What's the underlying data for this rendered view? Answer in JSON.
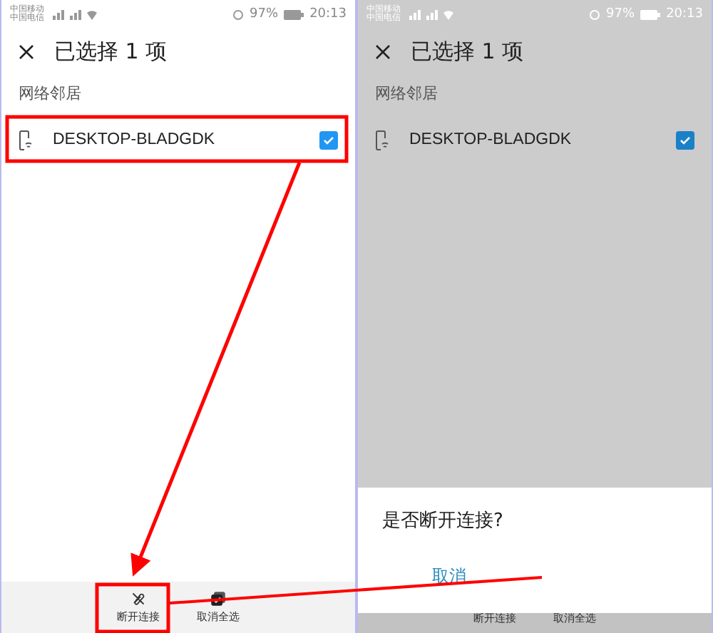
{
  "screens": [
    {
      "dimmed": false,
      "status_bar": {
        "carriers": [
          "中国移动",
          "中国电信"
        ],
        "battery": "97%",
        "time": "20:13"
      },
      "header": {
        "title": "已选择 1 项"
      },
      "section": "网络邻居",
      "devices": [
        {
          "name": "DESKTOP-BLADGDK",
          "checked": true
        }
      ],
      "bottom_bar": [
        {
          "kind": "unlink",
          "label": "断开连接"
        },
        {
          "kind": "deselect",
          "label": "取消全选"
        }
      ]
    },
    {
      "dimmed": true,
      "status_bar": {
        "carriers": [
          "中国移动",
          "中国电信"
        ],
        "battery": "97%",
        "time": "20:13"
      },
      "header": {
        "title": "已选择 1 项"
      },
      "section": "网络邻居",
      "devices": [
        {
          "name": "DESKTOP-BLADGDK",
          "checked": true
        }
      ],
      "bottom_bar": [
        {
          "label": "断开连接"
        },
        {
          "label": "取消全选"
        }
      ],
      "dialog": {
        "title": "是否断开连接?",
        "buttons": [
          "取消"
        ]
      }
    }
  ]
}
